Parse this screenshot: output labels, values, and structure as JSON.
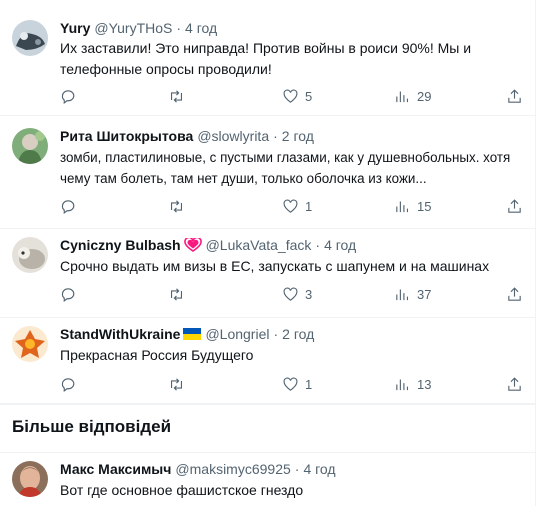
{
  "tweets": [
    {
      "name": "Yury",
      "handle": "@YuryTHoS",
      "sep": "·",
      "time": "4 год",
      "text": "Их заставили! Это ниправда! Против войны в роиси 90%! Мы и телефонные опросы проводили!",
      "replies": "",
      "retweets": "",
      "likes": "5",
      "views": "29"
    },
    {
      "name": "Рита Шитокрытова",
      "handle": "@slowlyrita",
      "sep": "·",
      "time": "2 год",
      "text": "зомби, пластилиновые, с пустыми глазами, как у душевнобольных. хотя чему там болеть, там нет души, только оболочка из кожи...",
      "replies": "",
      "retweets": "",
      "likes": "1",
      "views": "15"
    },
    {
      "name": "Cyniczny Bulbash",
      "handle": "@LukaVata_fack",
      "sep": "·",
      "time": "4 год",
      "text": "Срочно выдать им визы в ЕС, запускать с шапунем и на машинах",
      "replies": "",
      "retweets": "",
      "likes": "3",
      "views": "37"
    },
    {
      "name": "StandWithUkraine",
      "handle": "@Longriel",
      "sep": "·",
      "time": "2 год",
      "text": "Прекрасная Россия Будущего",
      "replies": "",
      "retweets": "",
      "likes": "1",
      "views": "13"
    },
    {
      "name": "Макс Максимыч",
      "handle": "@maksimyc69925",
      "sep": "·",
      "time": "4 год",
      "text": "Вот где основное фашистское гнездо"
    }
  ],
  "more_replies": "Більше відповідей",
  "icons": {
    "reply": "reply-icon",
    "retweet": "retweet-icon",
    "like": "heart-icon",
    "views": "views-icon",
    "share": "share-icon"
  },
  "colors": {
    "text": "#0f1419",
    "secondary": "#536471",
    "divider": "#eff3f4",
    "heart_badge": "#f91880",
    "flag_blue": "#0057b7",
    "flag_yellow": "#ffd700"
  }
}
